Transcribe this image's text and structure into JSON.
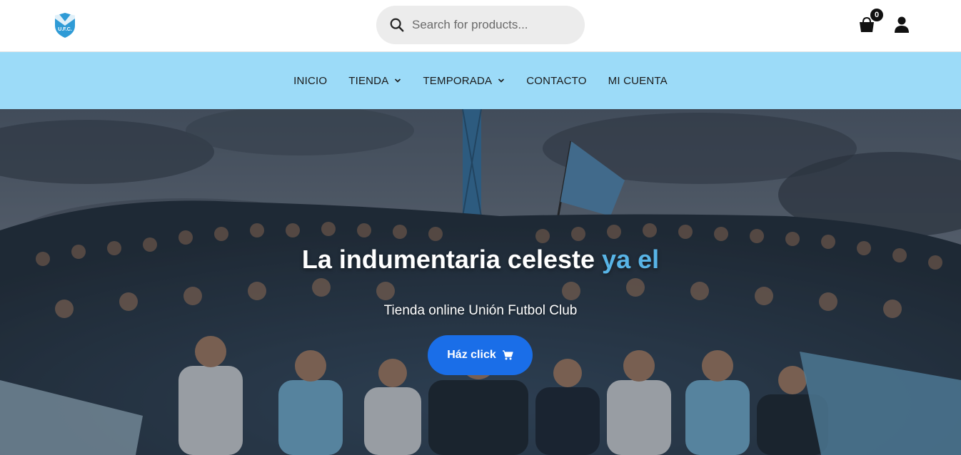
{
  "header": {
    "logo_text": "U.F.C.",
    "search_placeholder": "Search for products...",
    "cart_count": "0"
  },
  "nav": {
    "items": [
      {
        "label": "INICIO"
      },
      {
        "label": "TIENDA"
      },
      {
        "label": "TEMPORADA"
      },
      {
        "label": "CONTACTO"
      },
      {
        "label": "MI CUENTA"
      }
    ]
  },
  "hero": {
    "title_main": "La indumentaria celeste",
    "title_accent": "ya el",
    "subtitle": "Tienda online Unión Futbol Club",
    "button_label": "Ház click",
    "button_icon": "cart-icon"
  },
  "colors": {
    "nav_bg": "#9cdbf8",
    "button_bg": "#1a6ee8",
    "accent_text": "#58b4e6",
    "logo_blue": "#2f9bd6"
  }
}
